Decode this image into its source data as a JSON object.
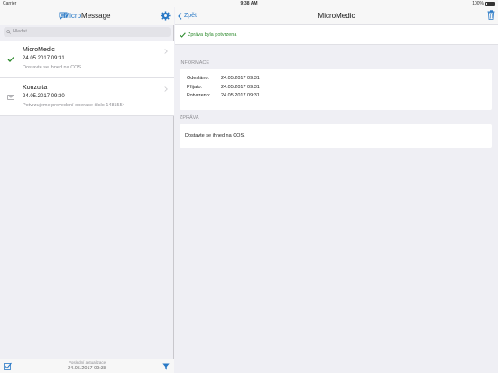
{
  "status": {
    "carrier": "Carrier",
    "time": "9:38 AM",
    "battery": "100%"
  },
  "app": {
    "title_part1": "Micro",
    "title_part2": "Message"
  },
  "search": {
    "placeholder": "Hledat"
  },
  "messages": [
    {
      "title": "MicroMedic",
      "date": "24.05.2017 09:31",
      "snippet": "Dostavte se ihned na COS.",
      "status_icon": "checkmark-icon"
    },
    {
      "title": "Konzulta",
      "date": "24.05.2017 09:30",
      "snippet": "Potvrzujeme provedení operace číslo 1481554",
      "status_icon": "envelope-icon"
    }
  ],
  "footer": {
    "update_label": "Poslední aktualizace",
    "update_time": "24.05.2017 09:38"
  },
  "detail": {
    "back_label": "Zpět",
    "title": "MicroMedic",
    "confirm_text": "Zpráva byla potvrzena",
    "info_section": "INFORMACE",
    "info": [
      {
        "key": "Odesláno:",
        "value": "24.05.2017 09:31"
      },
      {
        "key": "Přijato:",
        "value": "24.05.2017 09:31"
      },
      {
        "key": "Potvrzeno:",
        "value": "24.05.2017 09:31"
      }
    ],
    "message_section": "ZPRÁVA",
    "message_text": "Dostavte se ihned na COS."
  },
  "colors": {
    "accent": "#2979c6",
    "confirm": "#2e8b2e",
    "background": "#efeff4"
  }
}
